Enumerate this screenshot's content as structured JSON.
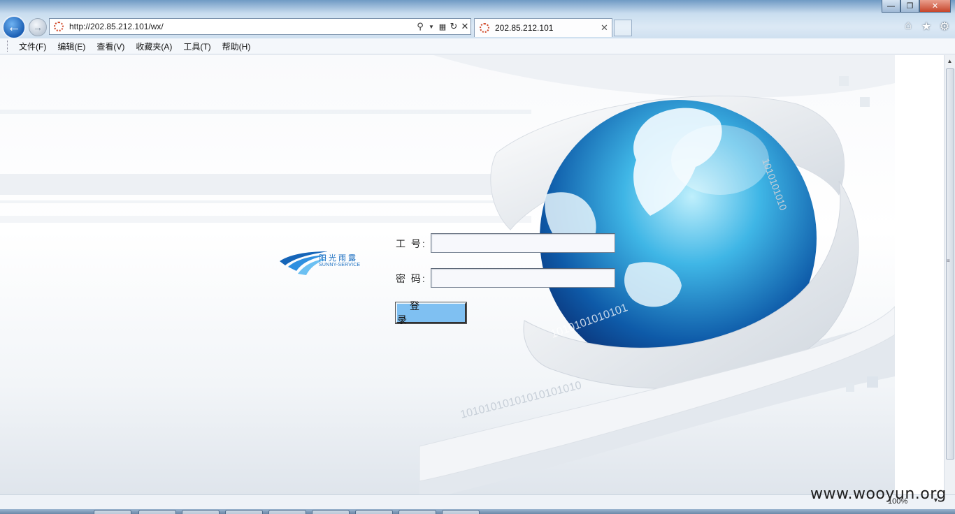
{
  "window": {
    "minimize_icon": "minimize-icon",
    "maximize_icon": "restore-icon",
    "close_icon": "close-icon"
  },
  "nav": {
    "back_icon": "back-arrow-icon",
    "forward_icon": "forward-arrow-icon"
  },
  "address_bar": {
    "url": "http://202.85.212.101/wx/"
  },
  "tab": {
    "title": "202.85.212.101"
  },
  "menu": {
    "items": [
      "文件(F)",
      "编辑(E)",
      "查看(V)",
      "收藏夹(A)",
      "工具(T)",
      "帮助(H)"
    ]
  },
  "logo": {
    "name_cn": "阳光雨露",
    "name_en": "SUNNY-SERVICE"
  },
  "login": {
    "id_label": "工 号:",
    "password_label": "密 码:",
    "id_value": "",
    "password_value": "",
    "submit_label": "登 录"
  },
  "status_bar": {
    "zoom": "100%"
  },
  "watermark": {
    "text": "www.wooyun.org"
  },
  "colors": {
    "button": "#7fc0f2",
    "brand": "#1b6fc1"
  }
}
